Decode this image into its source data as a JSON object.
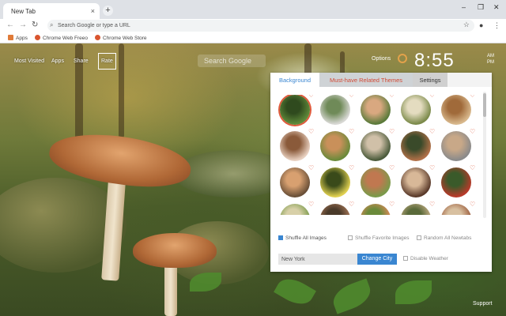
{
  "browser": {
    "tab_title": "New Tab",
    "tab_close": "×",
    "new_tab": "+",
    "window_minimize": "–",
    "window_restore": "❐",
    "window_close": "✕",
    "omnibox_placeholder": "Search Google or type a URL",
    "bookmarks": [
      {
        "label": "Apps",
        "icon_color": "#e07b39"
      },
      {
        "label": "Chrome Web Freeo",
        "icon_color": "#d9552f"
      },
      {
        "label": "Chrome Web Store",
        "icon_color": "#d9552f"
      }
    ]
  },
  "ntp": {
    "nav": {
      "most_visited": "Most Visited",
      "apps": "Apps",
      "share": "Share",
      "rate": "Rate"
    },
    "search_hint": "Search Google",
    "options_label": "Options",
    "time": "8:55",
    "ampm_top": "AM",
    "ampm_bottom": "PM",
    "support_label": "Support"
  },
  "panel": {
    "tabs": {
      "background": "Background",
      "related": "Must-have Related Themes",
      "settings": "Settings"
    },
    "accent_color": "#3a86d1",
    "heart_color": "#e05a3c",
    "thumbnails": [
      {
        "colors": [
          "#5f8a3a",
          "#2f4a1e"
        ]
      },
      {
        "colors": [
          "#d8d8d4",
          "#6f8a58"
        ]
      },
      {
        "colors": [
          "#5a7a3a",
          "#d9a880"
        ]
      },
      {
        "colors": [
          "#7b8a4a",
          "#e4dcc0"
        ]
      },
      {
        "colors": [
          "#d8b88c",
          "#a06a3a"
        ]
      },
      {
        "colors": [
          "#e8d0c0",
          "#8a5a3a"
        ]
      },
      {
        "colors": [
          "#6a8a3a",
          "#c9905a"
        ]
      },
      {
        "colors": [
          "#4a5a3a",
          "#d0c0a8"
        ]
      },
      {
        "colors": [
          "#b07048",
          "#3a4a2a"
        ]
      },
      {
        "colors": [
          "#8a8a8a",
          "#c8a888"
        ]
      },
      {
        "colors": [
          "#6a5038",
          "#d8a070"
        ]
      },
      {
        "colors": [
          "#e0d050",
          "#3a4a1a"
        ]
      },
      {
        "colors": [
          "#7a9a4a",
          "#c07850"
        ]
      },
      {
        "colors": [
          "#5a3a2a",
          "#d8b898"
        ]
      },
      {
        "colors": [
          "#b83a2a",
          "#3a5a2a"
        ]
      },
      {
        "colors": [
          "#7a9a4a",
          "#d8d0a8"
        ]
      },
      {
        "colors": [
          "#a87858",
          "#4a3a2a"
        ]
      },
      {
        "colors": [
          "#e08a5a",
          "#6a8a3a"
        ]
      },
      {
        "colors": [
          "#c8b088",
          "#5a6a3a"
        ]
      },
      {
        "colors": [
          "#9a5a3a",
          "#d8c0a0"
        ]
      }
    ],
    "options": {
      "shuffle_all": "Shuffle All Images",
      "shuffle_favorite": "Shuffle Favorite Images",
      "random_all": "Random All Newtabs"
    },
    "city_value": "New York",
    "change_city": "Change City",
    "disable_weather": "Disable Weather"
  }
}
